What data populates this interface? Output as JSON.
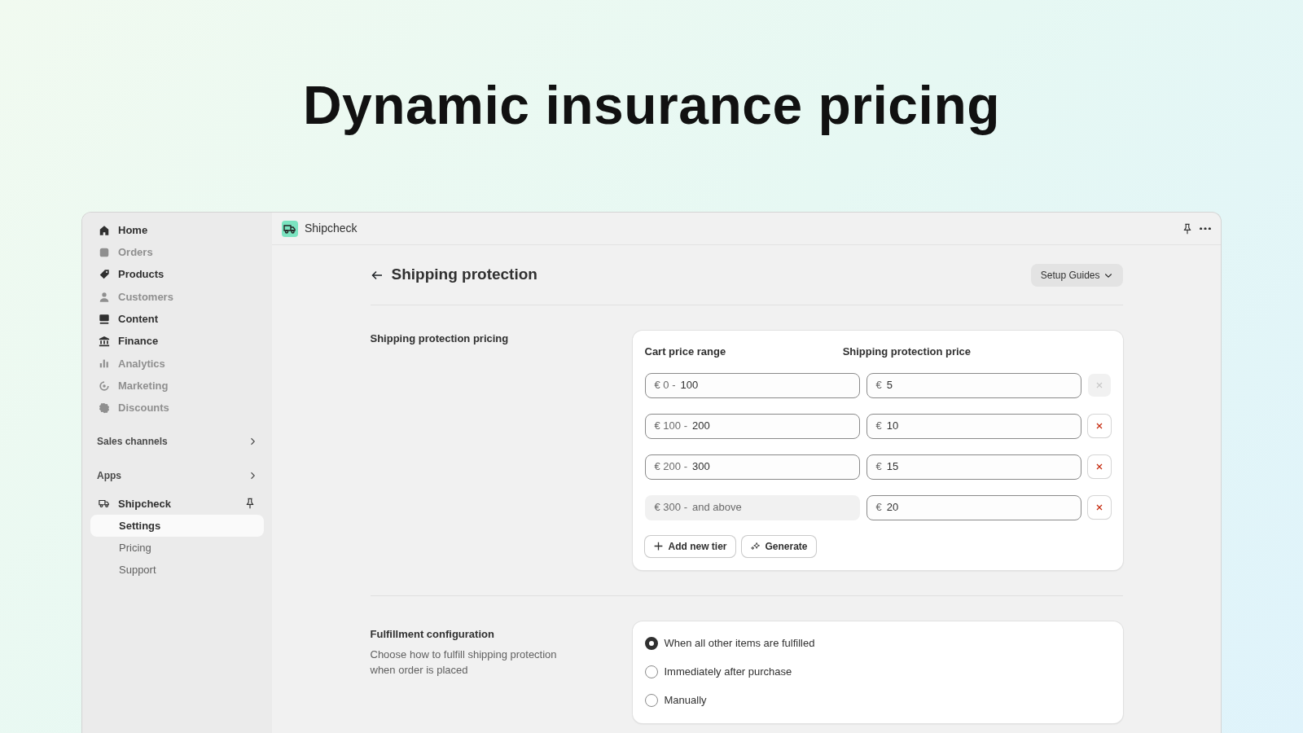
{
  "headline": "Dynamic insurance pricing",
  "sidebar": {
    "nav": [
      {
        "label": "Home",
        "disabled": false
      },
      {
        "label": "Orders",
        "disabled": true
      },
      {
        "label": "Products",
        "disabled": false
      },
      {
        "label": "Customers",
        "disabled": true
      },
      {
        "label": "Content",
        "disabled": false
      },
      {
        "label": "Finance",
        "disabled": false
      },
      {
        "label": "Analytics",
        "disabled": true
      },
      {
        "label": "Marketing",
        "disabled": true
      },
      {
        "label": "Discounts",
        "disabled": true
      }
    ],
    "sections": [
      {
        "label": "Sales channels"
      },
      {
        "label": "Apps"
      }
    ],
    "app": {
      "label": "Shipcheck",
      "children": [
        {
          "label": "Settings",
          "selected": true
        },
        {
          "label": "Pricing",
          "selected": false
        },
        {
          "label": "Support",
          "selected": false
        }
      ]
    }
  },
  "topbar": {
    "app_name": "Shipcheck"
  },
  "page": {
    "title": "Shipping protection",
    "setup_button": "Setup Guides"
  },
  "pricing": {
    "title": "Shipping protection pricing",
    "columns": [
      "Cart price range",
      "Shipping protection price"
    ],
    "tiers": [
      {
        "from": "€ 0 -",
        "to": "100",
        "to_disabled": false,
        "price_prefix": "€",
        "price": "5",
        "delete_disabled": true
      },
      {
        "from": "€ 100 -",
        "to": "200",
        "to_disabled": false,
        "price_prefix": "€",
        "price": "10",
        "delete_disabled": false
      },
      {
        "from": "€ 200 -",
        "to": "300",
        "to_disabled": false,
        "price_prefix": "€",
        "price": "15",
        "delete_disabled": false
      },
      {
        "from": "€ 300 -",
        "to": "and above",
        "to_disabled": true,
        "price_prefix": "€",
        "price": "20",
        "delete_disabled": false
      }
    ],
    "buttons": [
      {
        "kind": "add",
        "label": "Add new tier"
      },
      {
        "kind": "generate",
        "label": "Generate"
      }
    ]
  },
  "fulfillment": {
    "title": "Fulfillment configuration",
    "description": "Choose how to fulfill shipping protection when order is placed",
    "options": [
      {
        "label": "When all other items are fulfilled",
        "selected": true
      },
      {
        "label": "Immediately after purchase",
        "selected": false
      },
      {
        "label": "Manually",
        "selected": false
      }
    ]
  }
}
